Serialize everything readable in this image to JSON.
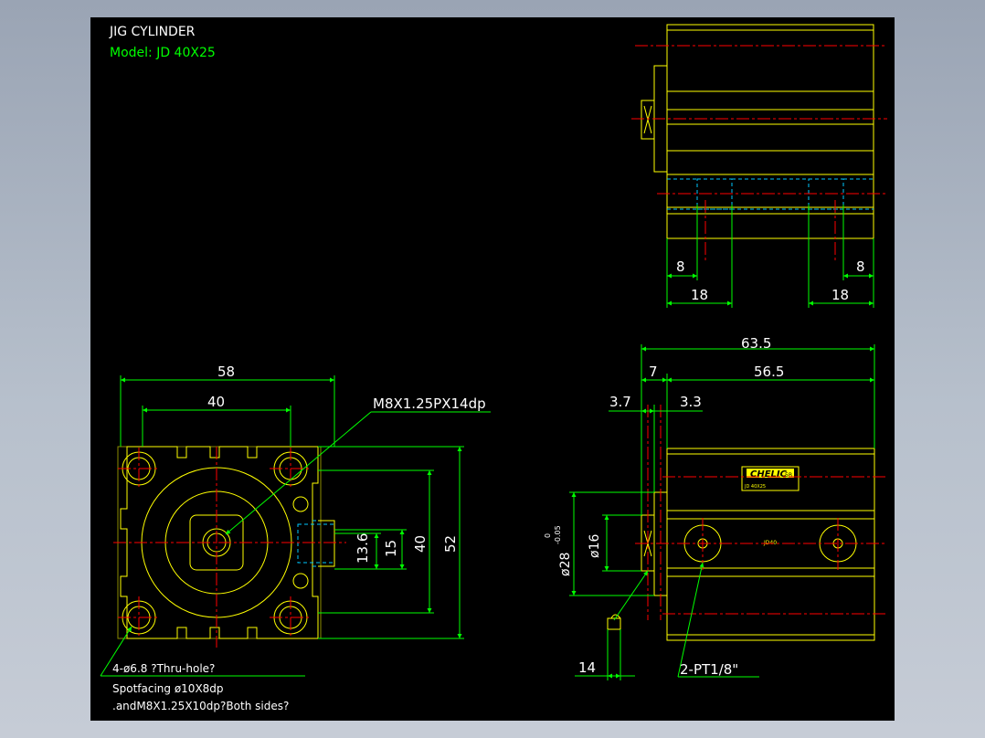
{
  "title": {
    "line1": "JIG CYLINDER",
    "line2": "Model: JD 40X25"
  },
  "colors": {
    "background": "#000000",
    "outline": "#ffff00",
    "dimension": "#00ff00",
    "centerline": "#ff0000",
    "hidden": "#00c8ff",
    "label": "#ffffff"
  },
  "top_view": {
    "dims": {
      "left_8": "8",
      "right_8": "8",
      "left_18": "18",
      "right_18": "18"
    }
  },
  "front_view": {
    "dims": {
      "width_58": "58",
      "width_40": "40",
      "height_13_6": "13.6",
      "height_15": "15",
      "height_40": "40",
      "height_52": "52"
    },
    "thread_callout": "M8X1.25PX14dp",
    "notes": [
      "4-ø6.8 ?Thru-hole?",
      "Spotfacing ø10X8dp",
      ".andM8X1.25X10dp?Both sides?"
    ]
  },
  "side_view": {
    "dims": {
      "total_63_5": "63.5",
      "left_7": "7",
      "main_56_5": "56.5",
      "left_3_7": "3.7",
      "right_3_3": "3.3",
      "dia_16": "ø16",
      "dia_28": "ø28",
      "tol_upper": "0",
      "tol_lower": "-0.05",
      "bottom_14": "14"
    },
    "port_callout": "2-PT1/8\"",
    "nameplate_brand": "CHELIC",
    "nameplate_suffix": "5B",
    "nameplate_line2": "JD 40X25",
    "body_mark": "JD40"
  }
}
